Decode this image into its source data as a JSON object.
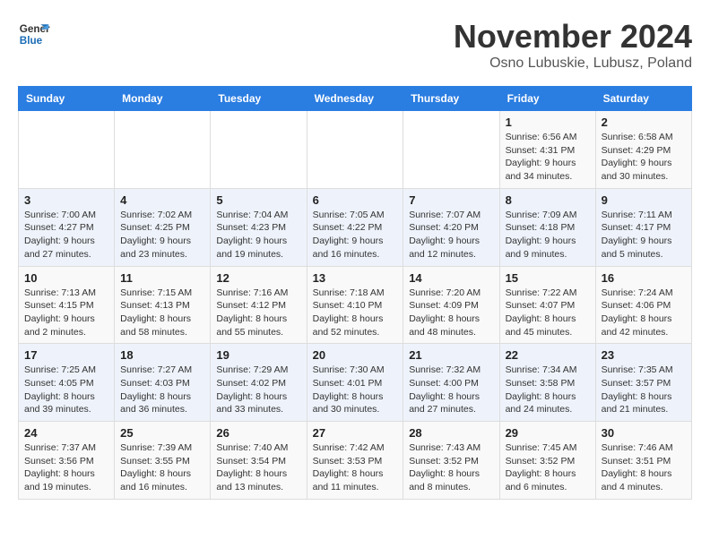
{
  "logo": {
    "line1": "General",
    "line2": "Blue"
  },
  "title": "November 2024",
  "subtitle": "Osno Lubuskie, Lubusz, Poland",
  "weekdays": [
    "Sunday",
    "Monday",
    "Tuesday",
    "Wednesday",
    "Thursday",
    "Friday",
    "Saturday"
  ],
  "weeks": [
    [
      {
        "day": "",
        "info": ""
      },
      {
        "day": "",
        "info": ""
      },
      {
        "day": "",
        "info": ""
      },
      {
        "day": "",
        "info": ""
      },
      {
        "day": "",
        "info": ""
      },
      {
        "day": "1",
        "info": "Sunrise: 6:56 AM\nSunset: 4:31 PM\nDaylight: 9 hours\nand 34 minutes."
      },
      {
        "day": "2",
        "info": "Sunrise: 6:58 AM\nSunset: 4:29 PM\nDaylight: 9 hours\nand 30 minutes."
      }
    ],
    [
      {
        "day": "3",
        "info": "Sunrise: 7:00 AM\nSunset: 4:27 PM\nDaylight: 9 hours\nand 27 minutes."
      },
      {
        "day": "4",
        "info": "Sunrise: 7:02 AM\nSunset: 4:25 PM\nDaylight: 9 hours\nand 23 minutes."
      },
      {
        "day": "5",
        "info": "Sunrise: 7:04 AM\nSunset: 4:23 PM\nDaylight: 9 hours\nand 19 minutes."
      },
      {
        "day": "6",
        "info": "Sunrise: 7:05 AM\nSunset: 4:22 PM\nDaylight: 9 hours\nand 16 minutes."
      },
      {
        "day": "7",
        "info": "Sunrise: 7:07 AM\nSunset: 4:20 PM\nDaylight: 9 hours\nand 12 minutes."
      },
      {
        "day": "8",
        "info": "Sunrise: 7:09 AM\nSunset: 4:18 PM\nDaylight: 9 hours\nand 9 minutes."
      },
      {
        "day": "9",
        "info": "Sunrise: 7:11 AM\nSunset: 4:17 PM\nDaylight: 9 hours\nand 5 minutes."
      }
    ],
    [
      {
        "day": "10",
        "info": "Sunrise: 7:13 AM\nSunset: 4:15 PM\nDaylight: 9 hours\nand 2 minutes."
      },
      {
        "day": "11",
        "info": "Sunrise: 7:15 AM\nSunset: 4:13 PM\nDaylight: 8 hours\nand 58 minutes."
      },
      {
        "day": "12",
        "info": "Sunrise: 7:16 AM\nSunset: 4:12 PM\nDaylight: 8 hours\nand 55 minutes."
      },
      {
        "day": "13",
        "info": "Sunrise: 7:18 AM\nSunset: 4:10 PM\nDaylight: 8 hours\nand 52 minutes."
      },
      {
        "day": "14",
        "info": "Sunrise: 7:20 AM\nSunset: 4:09 PM\nDaylight: 8 hours\nand 48 minutes."
      },
      {
        "day": "15",
        "info": "Sunrise: 7:22 AM\nSunset: 4:07 PM\nDaylight: 8 hours\nand 45 minutes."
      },
      {
        "day": "16",
        "info": "Sunrise: 7:24 AM\nSunset: 4:06 PM\nDaylight: 8 hours\nand 42 minutes."
      }
    ],
    [
      {
        "day": "17",
        "info": "Sunrise: 7:25 AM\nSunset: 4:05 PM\nDaylight: 8 hours\nand 39 minutes."
      },
      {
        "day": "18",
        "info": "Sunrise: 7:27 AM\nSunset: 4:03 PM\nDaylight: 8 hours\nand 36 minutes."
      },
      {
        "day": "19",
        "info": "Sunrise: 7:29 AM\nSunset: 4:02 PM\nDaylight: 8 hours\nand 33 minutes."
      },
      {
        "day": "20",
        "info": "Sunrise: 7:30 AM\nSunset: 4:01 PM\nDaylight: 8 hours\nand 30 minutes."
      },
      {
        "day": "21",
        "info": "Sunrise: 7:32 AM\nSunset: 4:00 PM\nDaylight: 8 hours\nand 27 minutes."
      },
      {
        "day": "22",
        "info": "Sunrise: 7:34 AM\nSunset: 3:58 PM\nDaylight: 8 hours\nand 24 minutes."
      },
      {
        "day": "23",
        "info": "Sunrise: 7:35 AM\nSunset: 3:57 PM\nDaylight: 8 hours\nand 21 minutes."
      }
    ],
    [
      {
        "day": "24",
        "info": "Sunrise: 7:37 AM\nSunset: 3:56 PM\nDaylight: 8 hours\nand 19 minutes."
      },
      {
        "day": "25",
        "info": "Sunrise: 7:39 AM\nSunset: 3:55 PM\nDaylight: 8 hours\nand 16 minutes."
      },
      {
        "day": "26",
        "info": "Sunrise: 7:40 AM\nSunset: 3:54 PM\nDaylight: 8 hours\nand 13 minutes."
      },
      {
        "day": "27",
        "info": "Sunrise: 7:42 AM\nSunset: 3:53 PM\nDaylight: 8 hours\nand 11 minutes."
      },
      {
        "day": "28",
        "info": "Sunrise: 7:43 AM\nSunset: 3:52 PM\nDaylight: 8 hours\nand 8 minutes."
      },
      {
        "day": "29",
        "info": "Sunrise: 7:45 AM\nSunset: 3:52 PM\nDaylight: 8 hours\nand 6 minutes."
      },
      {
        "day": "30",
        "info": "Sunrise: 7:46 AM\nSunset: 3:51 PM\nDaylight: 8 hours\nand 4 minutes."
      }
    ]
  ]
}
